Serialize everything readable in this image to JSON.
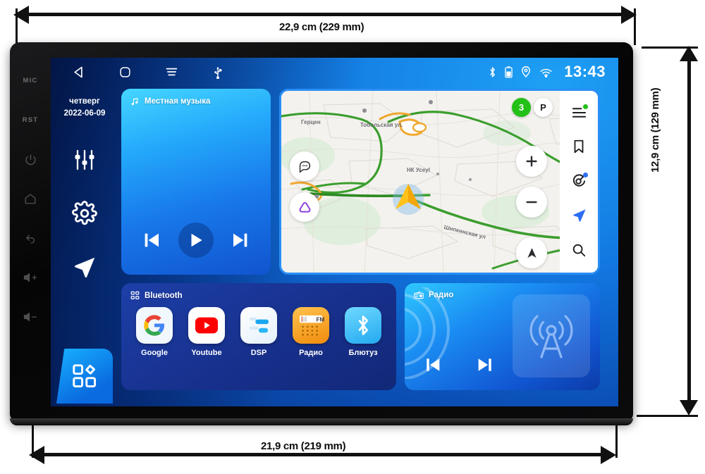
{
  "annotations": {
    "top_width": "22,9 cm (229 mm)",
    "bottom_width": "21,9 cm (219 mm)",
    "right_height": "12,9 cm (129 mm)"
  },
  "device": {
    "bezel_buttons": [
      {
        "label": "MIC",
        "icon": "microphone-label"
      },
      {
        "label": "RST",
        "icon": "reset-label"
      },
      {
        "label": "",
        "icon": "power-icon"
      },
      {
        "label": "",
        "icon": "home-icon"
      },
      {
        "label": "",
        "icon": "back-arrow-icon"
      },
      {
        "label": "",
        "icon": "volume-up-icon"
      },
      {
        "label": "",
        "icon": "volume-down-icon"
      }
    ]
  },
  "statusbar": {
    "nav": [
      {
        "name": "back",
        "icon": "back-triangle-icon"
      },
      {
        "name": "home",
        "icon": "home-square-icon"
      },
      {
        "name": "menu",
        "icon": "hamburger-icon"
      },
      {
        "name": "usb",
        "icon": "usb-icon"
      }
    ],
    "indicators": [
      {
        "name": "bluetooth",
        "icon": "bluetooth-icon"
      },
      {
        "name": "battery",
        "icon": "battery-icon"
      },
      {
        "name": "location",
        "icon": "location-pin-icon"
      },
      {
        "name": "wifi",
        "icon": "wifi-icon"
      }
    ],
    "clock": "13:43"
  },
  "rail": {
    "weekday": "четверг",
    "date": "2022-06-09",
    "equalizer_icon": "equalizer-sliders-icon",
    "settings_icon": "gear-icon",
    "navigation_icon": "navigation-arrow-icon",
    "apps_icon": "app-grid-icon"
  },
  "music_card": {
    "title": "Местная музыка",
    "title_icon": "music-note-icon",
    "controls": [
      {
        "name": "previous",
        "icon": "skip-previous-icon"
      },
      {
        "name": "play",
        "icon": "play-icon"
      },
      {
        "name": "next",
        "icon": "skip-next-icon"
      }
    ]
  },
  "map_card": {
    "traffic_level": "3",
    "parking_label": "P",
    "street_labels": [
      "Тобольская ул.",
      "НК Усеуl",
      "Шипкинская ул",
      "Герцен",
      "НК"
    ],
    "left_buttons": [
      {
        "name": "chat",
        "icon": "chat-bubble-icon"
      },
      {
        "name": "alice",
        "icon": "alice-triangle-icon"
      }
    ],
    "zoom_buttons": [
      {
        "name": "zoom-in",
        "icon": "plus-icon"
      },
      {
        "name": "zoom-out",
        "icon": "minus-icon"
      },
      {
        "name": "compass",
        "icon": "compass-arrow-icon"
      }
    ],
    "panel_buttons": [
      {
        "name": "menu",
        "icon": "menu-lines-icon"
      },
      {
        "name": "bookmarks",
        "icon": "bookmark-icon"
      },
      {
        "name": "alice-assistant",
        "icon": "alice-radar-icon"
      },
      {
        "name": "navigate",
        "icon": "navigate-arrow-icon"
      },
      {
        "name": "search",
        "icon": "search-icon"
      }
    ]
  },
  "apps_card": {
    "title": "Bluetooth",
    "title_icon": "apps-grid-icon",
    "apps": [
      {
        "label": "Google",
        "icon": "google-icon"
      },
      {
        "label": "Youtube",
        "icon": "youtube-icon"
      },
      {
        "label": "DSP",
        "icon": "dsp-equalizer-icon"
      },
      {
        "label": "Радио",
        "icon": "radio-fm-icon"
      },
      {
        "label": "Блютуз",
        "icon": "bluetooth-app-icon"
      }
    ]
  },
  "radio_card": {
    "title": "Радио",
    "title_icon": "radio-device-icon",
    "art_icon": "radio-tower-icon",
    "controls": [
      {
        "name": "previous",
        "icon": "skip-previous-icon"
      },
      {
        "name": "next",
        "icon": "skip-next-icon"
      }
    ]
  },
  "colors": {
    "accent_blue": "#1a8cf2",
    "deep_blue": "#0b4fb5",
    "apps_card_bg": "#17308c",
    "traffic_green": "#23c017",
    "radio_orange": "#f59a1b",
    "youtube_red": "#ff0000"
  }
}
